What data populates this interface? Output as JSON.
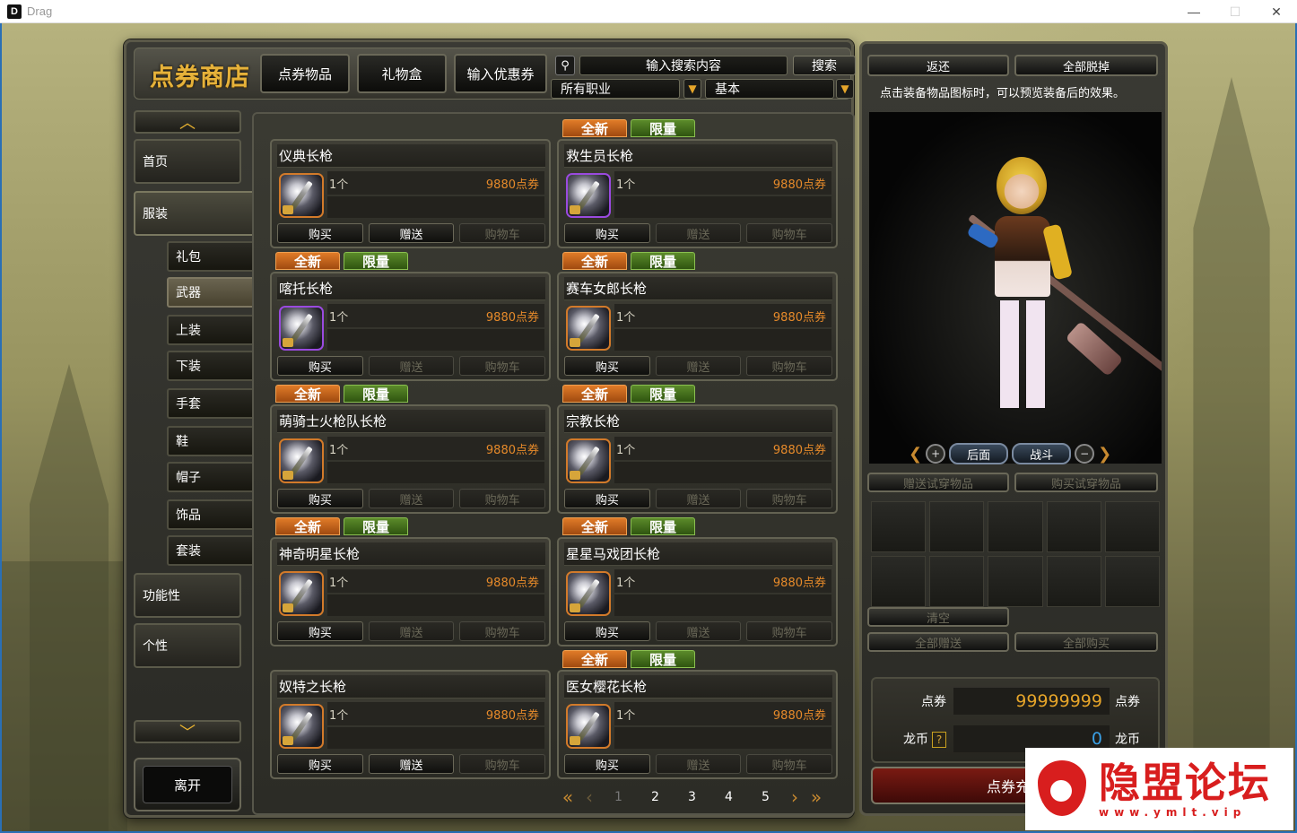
{
  "window": {
    "title": "Drag",
    "logo_text": "D",
    "minimize": "—",
    "maximize": "☐",
    "close": "✕"
  },
  "header": {
    "shop_title": "点券商店",
    "tabs": [
      "点券物品",
      "礼物盒",
      "输入优惠券"
    ],
    "search_placeholder": "输入搜索内容",
    "search_button": "搜索",
    "job_select": "所有职业",
    "type_select": "基本"
  },
  "nav": {
    "scroll_up": "︿",
    "scroll_down": "﹀",
    "home": "首页",
    "clothing": "服装",
    "sub_items": [
      "礼包",
      "武器",
      "上装",
      "下装",
      "手套",
      "鞋",
      "帽子",
      "饰品",
      "套装"
    ],
    "active_sub": "武器",
    "functional": "功能性",
    "personal": "个性",
    "leave": "离开"
  },
  "tags": {
    "new": "全新",
    "limited": "限量"
  },
  "item_buttons": {
    "buy": "购买",
    "gift": "赠送",
    "cart": "购物车"
  },
  "items": [
    {
      "name": "仪典长枪",
      "qty": "1个",
      "price": "9880点券",
      "gift_enabled": true,
      "icon_border": "orange"
    },
    {
      "name": "救生员长枪",
      "qty": "1个",
      "price": "9880点券",
      "gift_enabled": false,
      "icon_border": "purple"
    },
    {
      "name": "喀托长枪",
      "qty": "1个",
      "price": "9880点券",
      "gift_enabled": false,
      "icon_border": "purple"
    },
    {
      "name": "赛车女郎长枪",
      "qty": "1个",
      "price": "9880点券",
      "gift_enabled": false,
      "icon_border": "orange"
    },
    {
      "name": "萌骑士火枪队长枪",
      "qty": "1个",
      "price": "9880点券",
      "gift_enabled": false,
      "icon_border": "orange"
    },
    {
      "name": "宗教长枪",
      "qty": "1个",
      "price": "9880点券",
      "gift_enabled": false,
      "icon_border": "orange"
    },
    {
      "name": "神奇明星长枪",
      "qty": "1个",
      "price": "9880点券",
      "gift_enabled": false,
      "icon_border": "orange"
    },
    {
      "name": "星星马戏团长枪",
      "qty": "1个",
      "price": "9880点券",
      "gift_enabled": false,
      "icon_border": "orange"
    },
    {
      "name": "奴特之长枪",
      "qty": "1个",
      "price": "9880点券",
      "gift_enabled": true,
      "icon_border": "orange"
    },
    {
      "name": "医女樱花长枪",
      "qty": "1个",
      "price": "9880点券",
      "gift_enabled": false,
      "icon_border": "orange"
    }
  ],
  "pager": {
    "pages": [
      "1",
      "2",
      "3",
      "4",
      "5"
    ],
    "current": "1"
  },
  "preview": {
    "return_btn": "返还",
    "undress_btn": "全部脱掉",
    "hint": "点击装备物品图标时，可以预览装备后的效果。",
    "back_view": "后面",
    "battle": "战斗",
    "gift_trial": "赠送试穿物品",
    "buy_trial": "购买试穿物品",
    "clear": "清空",
    "gift_all": "全部赠送",
    "buy_all": "全部购买",
    "points_label": "点券",
    "points_value": "99999999",
    "points_unit": "点券",
    "dragon_label": "龙币",
    "dragon_value": "0",
    "dragon_unit": "龙币",
    "help": "?",
    "recharge": "点券充值"
  },
  "watermark": {
    "title": "隐盟论坛",
    "url": "www.ymlt.vip"
  },
  "colors": {
    "price": "#e68a2a",
    "points": "#e6a52a",
    "dragon": "#3aa0e6",
    "title_gold": "#e6b23a"
  }
}
